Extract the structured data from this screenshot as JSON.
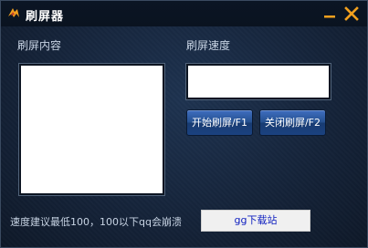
{
  "window": {
    "title": "刷屏器"
  },
  "labels": {
    "content": "刷屏内容",
    "speed": "刷屏速度"
  },
  "inputs": {
    "content_value": "",
    "speed_value": ""
  },
  "buttons": {
    "start": "开始刷屏/F1",
    "stop": "关闭刷屏/F2",
    "download": "gg下载站"
  },
  "hint": "速度建议最低100，100以下qq会崩溃",
  "colors": {
    "accent_orange": "#f2a01e",
    "button_blue": "#25508f",
    "link_blue": "#1020c0"
  }
}
